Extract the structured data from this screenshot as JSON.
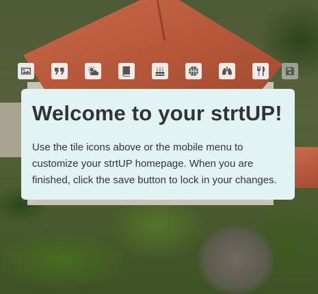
{
  "toolbar": {
    "icons": [
      {
        "name": "image-icon"
      },
      {
        "name": "quote-icon"
      },
      {
        "name": "weather-icon"
      },
      {
        "name": "book-icon"
      },
      {
        "name": "birthday-cake-icon"
      },
      {
        "name": "basketball-icon"
      },
      {
        "name": "lungs-icon"
      },
      {
        "name": "utensils-icon"
      },
      {
        "name": "save-icon"
      }
    ]
  },
  "welcome": {
    "title": "Welcome to your strtUP!",
    "body": "Use the tile icons above or the mobile menu to customize your strtUP homepage. When you are finished, click the save button to lock in your changes."
  }
}
